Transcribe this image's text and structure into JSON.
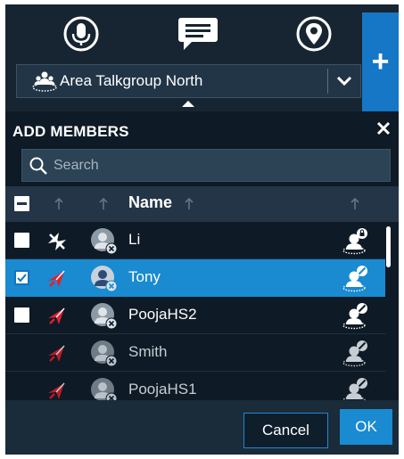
{
  "header": {
    "tabs": [
      {
        "icon": "microphone-icon"
      },
      {
        "icon": "chat-message-icon"
      },
      {
        "icon": "location-pin-icon"
      }
    ],
    "talkgroup": {
      "icon": "talkgroup-area-icon",
      "label": "Area Talkgroup North",
      "dropdown_icon": "chevron-down-icon"
    },
    "add_label": "+"
  },
  "panel": {
    "title": "ADD MEMBERS",
    "search": {
      "placeholder": "Search",
      "value": ""
    },
    "columns": {
      "name": "Name"
    },
    "members": [
      {
        "name": "Li",
        "checkbox": true,
        "checked": false,
        "selected": false,
        "status": "grey-offline-icon",
        "presence": "lock"
      },
      {
        "name": "Tony",
        "checkbox": true,
        "checked": true,
        "selected": true,
        "status": "red-radio-icon",
        "presence": "busy"
      },
      {
        "name": "PoojaHS2",
        "checkbox": true,
        "checked": false,
        "selected": false,
        "status": "red-radio-icon",
        "presence": "busy"
      },
      {
        "name": "Smith",
        "checkbox": false,
        "checked": false,
        "selected": false,
        "status": "red-radio-icon",
        "presence": "busy"
      },
      {
        "name": "PoojaHS1",
        "checkbox": false,
        "checked": false,
        "selected": false,
        "status": "red-radio-icon",
        "presence": "busy"
      }
    ],
    "buttons": {
      "cancel": "Cancel",
      "ok": "OK"
    }
  },
  "colors": {
    "accent": "#1A8AD1",
    "background": "#172532",
    "panel": "#0E1A26",
    "header_row": "#233547",
    "alert_red": "#E0202F"
  }
}
